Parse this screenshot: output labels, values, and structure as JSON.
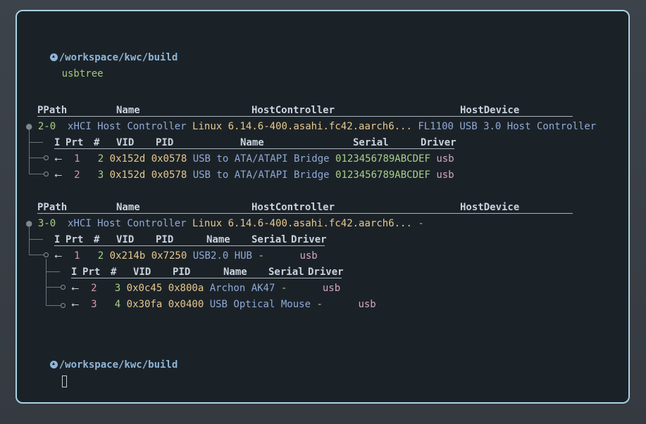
{
  "prompt": {
    "path": "/workspace/kwc/build",
    "apple_glyph": "",
    "command": "usbtree"
  },
  "headers": {
    "ppath": "PPath",
    "name": "Name",
    "host_controller": "HostController",
    "host_device": "HostDevice"
  },
  "dev_headers": {
    "i": "I",
    "prt": "Prt",
    "hash": "#",
    "vid": "VID",
    "pid": "PID",
    "name": "Name",
    "serial": "Serial",
    "driver": "Driver"
  },
  "buses": [
    {
      "path": "2-0",
      "name": "xHCI Host Controller",
      "host_controller": "Linux 6.14.6-400.asahi.fc42.aarch6...",
      "host_device": "FL1100 USB 3.0 Host Controller",
      "devices": [
        {
          "port": "1",
          "num": "2",
          "vid": "0x152d",
          "pid": "0x0578",
          "name": "USB to ATA/ATAPI Bridge",
          "serial": "0123456789ABCDEF",
          "driver": "usb"
        },
        {
          "port": "2",
          "num": "3",
          "vid": "0x152d",
          "pid": "0x0578",
          "name": "USB to ATA/ATAPI Bridge",
          "serial": "0123456789ABCDEF",
          "driver": "usb"
        }
      ]
    },
    {
      "path": "3-0",
      "name": "xHCI Host Controller",
      "host_controller": "Linux 6.14.6-400.asahi.fc42.aarch6...",
      "host_device": "-",
      "devices": [
        {
          "port": "1",
          "num": "2",
          "vid": "0x214b",
          "pid": "0x7250",
          "name": "USB2.0 HUB",
          "serial": "-",
          "driver": "usb"
        }
      ],
      "children": [
        {
          "port": "2",
          "num": "3",
          "vid": "0x0c45",
          "pid": "0x800a",
          "name": "Archon AK47",
          "serial": "-",
          "driver": "usb"
        },
        {
          "port": "3",
          "num": "4",
          "vid": "0x30fa",
          "pid": "0x0400",
          "name": "USB Optical Mouse",
          "serial": "-",
          "driver": "usb"
        }
      ]
    }
  ],
  "icons": {
    "home": "home-icon",
    "apple": "apple-icon",
    "usb": "usb-icon",
    "usb_glyph": "⭠"
  },
  "colors": {
    "border": "#a9d3e3",
    "background": "#1b2227",
    "prompt": "#8fb6d8",
    "accent_green": "#a7d08a",
    "hex_yellow": "#e6c88f",
    "name_blue": "#8fa9d9",
    "driver_pink": "#d6a6c4"
  }
}
